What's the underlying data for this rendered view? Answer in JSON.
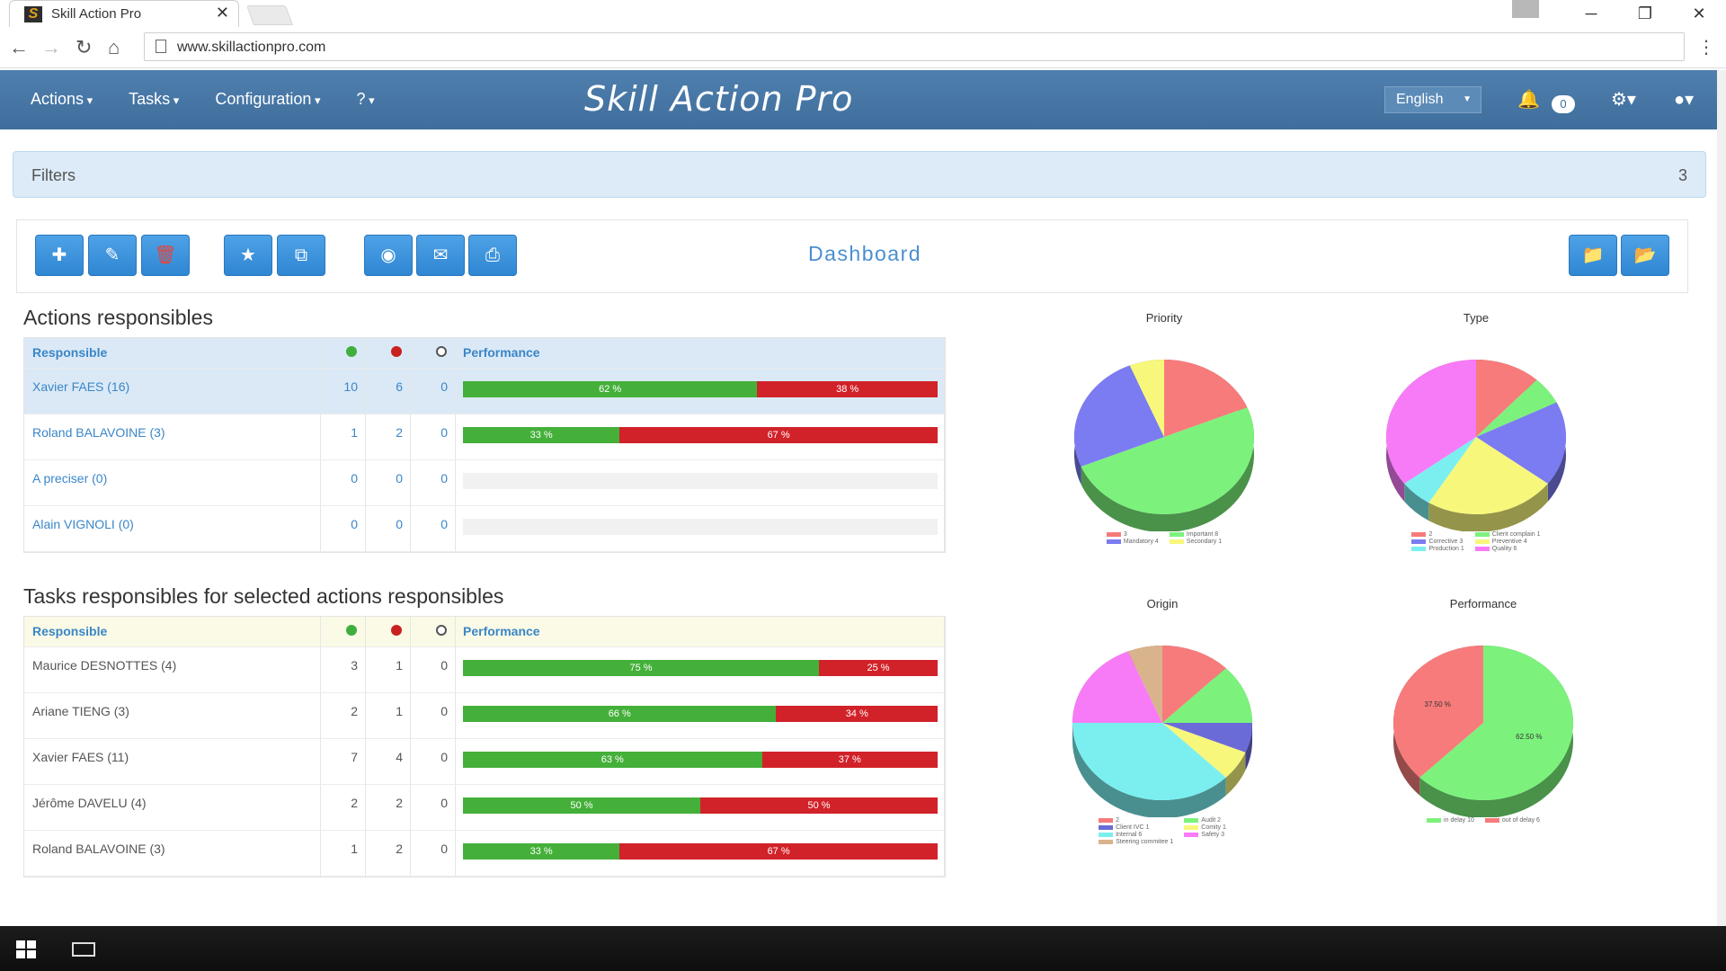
{
  "browser": {
    "tab_title": "Skill Action Pro",
    "tab_close": "✕",
    "url": "www.skillactionpro.com",
    "controls": {
      "minimize": "─",
      "restore": "❐",
      "close": "✕"
    }
  },
  "navbar": {
    "menus": [
      "Actions",
      "Tasks",
      "Configuration",
      "?"
    ],
    "brand": "Skill Action Pro",
    "language": "English",
    "notifications": "0"
  },
  "filters": {
    "label": "Filters",
    "count": "3"
  },
  "toolbar": {
    "title": "Dashboard"
  },
  "actions_section": {
    "title": "Actions responsibles",
    "header": {
      "responsible": "Responsible",
      "performance": "Performance"
    },
    "rows": [
      {
        "name": "Xavier FAES (16)",
        "green": "10",
        "red": "6",
        "other": "0",
        "ok": 62,
        "ko": 38,
        "ok_label": "62 %",
        "ko_label": "38 %"
      },
      {
        "name": "Roland BALAVOINE (3)",
        "green": "1",
        "red": "2",
        "other": "0",
        "ok": 33,
        "ko": 67,
        "ok_label": "33 %",
        "ko_label": "67 %"
      },
      {
        "name": "A preciser (0)",
        "green": "0",
        "red": "0",
        "other": "0",
        "ok": 0,
        "ko": 0,
        "ok_label": "",
        "ko_label": ""
      },
      {
        "name": "Alain VIGNOLI (0)",
        "green": "0",
        "red": "0",
        "other": "0",
        "ok": 0,
        "ko": 0,
        "ok_label": "",
        "ko_label": ""
      }
    ]
  },
  "tasks_section": {
    "title": "Tasks responsibles for selected actions responsibles",
    "header": {
      "responsible": "Responsible",
      "performance": "Performance"
    },
    "rows": [
      {
        "name": "Maurice DESNOTTES (4)",
        "green": "3",
        "red": "1",
        "other": "0",
        "ok": 75,
        "ko": 25,
        "ok_label": "75 %",
        "ko_label": "25 %"
      },
      {
        "name": "Ariane TIENG (3)",
        "green": "2",
        "red": "1",
        "other": "0",
        "ok": 66,
        "ko": 34,
        "ok_label": "66 %",
        "ko_label": "34 %"
      },
      {
        "name": "Xavier FAES (11)",
        "green": "7",
        "red": "4",
        "other": "0",
        "ok": 63,
        "ko": 37,
        "ok_label": "63 %",
        "ko_label": "37 %"
      },
      {
        "name": "Jérôme DAVELU (4)",
        "green": "2",
        "red": "2",
        "other": "0",
        "ok": 50,
        "ko": 50,
        "ok_label": "50 %",
        "ko_label": "50 %"
      },
      {
        "name": "Roland BALAVOINE (3)",
        "green": "1",
        "red": "2",
        "other": "0",
        "ok": 33,
        "ko": 67,
        "ok_label": "33 %",
        "ko_label": "67 %"
      }
    ]
  },
  "colors": {
    "green": "#44b03a",
    "red": "#d12229",
    "navbar": "#4676a5",
    "accent": "#3a86c8"
  },
  "chart_data": [
    {
      "type": "pie",
      "title": "Priority",
      "series": [
        {
          "name": "3",
          "value": 3,
          "color": "#f77b7b"
        },
        {
          "name": "Important 8",
          "value": 8,
          "color": "#7cf27c"
        },
        {
          "name": "Mandatory 4",
          "value": 4,
          "color": "#7b7bf2"
        },
        {
          "name": "Secondary 1",
          "value": 1,
          "color": "#f7f77b"
        }
      ]
    },
    {
      "type": "pie",
      "title": "Type",
      "series": [
        {
          "name": "2",
          "value": 2,
          "color": "#f77b7b"
        },
        {
          "name": "Client complain 1",
          "value": 1,
          "color": "#7cf27c"
        },
        {
          "name": "Corrective 3",
          "value": 3,
          "color": "#7b7bf2"
        },
        {
          "name": "Preventive 4",
          "value": 4,
          "color": "#f7f77b"
        },
        {
          "name": "Production 1",
          "value": 1,
          "color": "#7befef"
        },
        {
          "name": "Quality 6",
          "value": 6,
          "color": "#f77bf7"
        }
      ]
    },
    {
      "type": "pie",
      "title": "Origin",
      "series": [
        {
          "name": "2",
          "value": 2,
          "color": "#f77b7b"
        },
        {
          "name": "Audit 2",
          "value": 2,
          "color": "#7cf27c"
        },
        {
          "name": "Client IVC 1",
          "value": 1,
          "color": "#6b6bd8"
        },
        {
          "name": "Comity 1",
          "value": 1,
          "color": "#f7f77b"
        },
        {
          "name": "Internal 6",
          "value": 6,
          "color": "#7befef"
        },
        {
          "name": "Safety 3",
          "value": 3,
          "color": "#f77bf7"
        },
        {
          "name": "Steering commitee 1",
          "value": 1,
          "color": "#d9b38c"
        }
      ]
    },
    {
      "type": "pie",
      "title": "Performance",
      "series": [
        {
          "name": "in delay 10",
          "value": 10,
          "color": "#7cf27c",
          "label": "62.50 %"
        },
        {
          "name": "out of delay 6",
          "value": 6,
          "color": "#f77b7b",
          "label": "37.50 %"
        }
      ]
    }
  ]
}
